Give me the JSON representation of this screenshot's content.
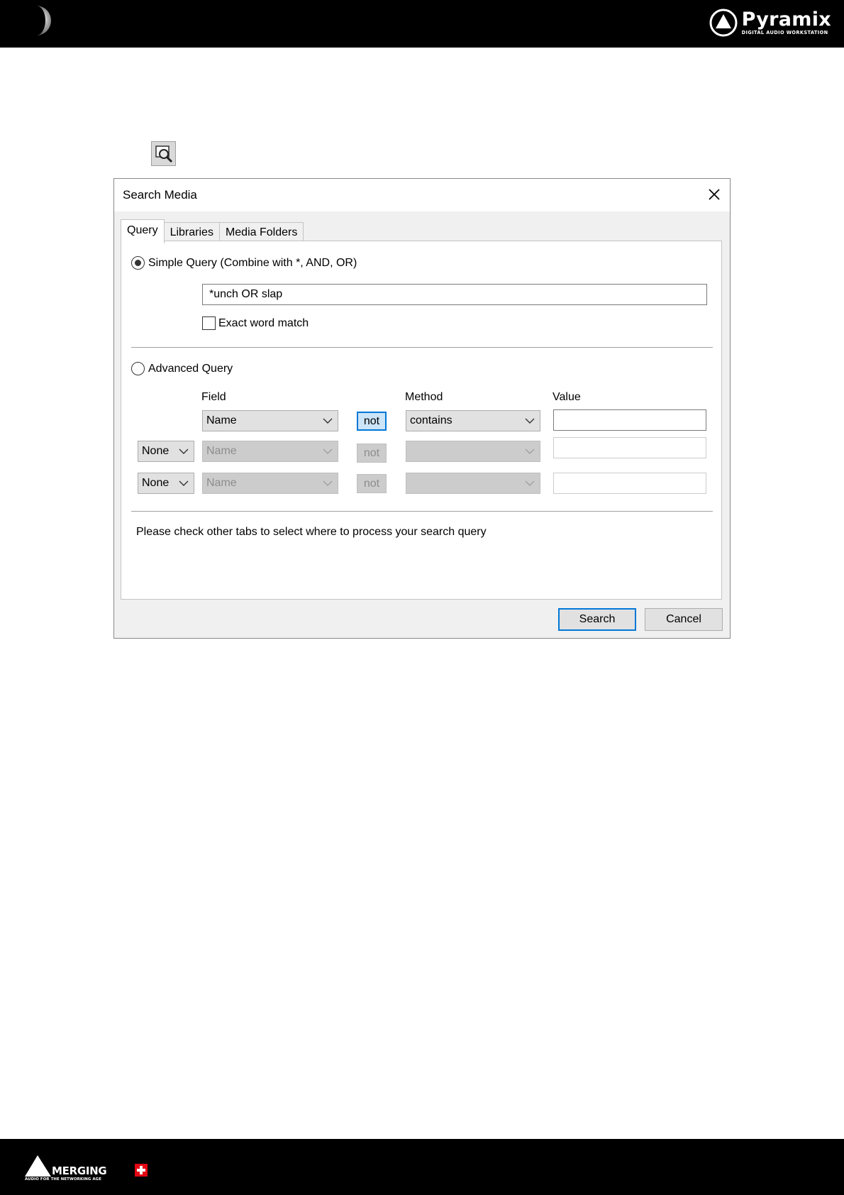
{
  "header": {
    "brand_name": "Pyramix",
    "brand_tagline": "DIGITAL AUDIO WORKSTATION",
    "moon_icon": "moon-icon"
  },
  "footer": {
    "brand_name": "MERGING",
    "brand_tagline": "AUDIO FOR THE NETWORKING AGE"
  },
  "toolbar": {
    "search_icon": "search-media-icon"
  },
  "dialog": {
    "title": "Search Media",
    "tabs": [
      {
        "label": "Query",
        "active": true
      },
      {
        "label": "Libraries",
        "active": false
      },
      {
        "label": "Media Folders",
        "active": false
      }
    ],
    "simple_query": {
      "label": "Simple Query  (Combine with *, AND, OR)",
      "selected": true,
      "value": "*unch OR slap",
      "exact_word_match_label": "Exact word match",
      "exact_word_match_checked": false
    },
    "advanced_query": {
      "label": "Advanced Query",
      "selected": false,
      "headers": {
        "field": "Field",
        "method": "Method",
        "value": "Value"
      },
      "rows": [
        {
          "operator": "",
          "field": "Name",
          "not_label": "not",
          "method": "contains",
          "value": ""
        },
        {
          "operator": "None",
          "field": "Name",
          "not_label": "not",
          "method": "",
          "value": ""
        },
        {
          "operator": "None",
          "field": "Name",
          "not_label": "not",
          "method": "",
          "value": ""
        }
      ]
    },
    "hint": "Please check other tabs to select where to process your search query",
    "buttons": {
      "search": "Search",
      "cancel": "Cancel"
    }
  },
  "colors": {
    "accent": "#0078d7",
    "bar_background": "#000000",
    "swiss_red": "#e30613"
  }
}
